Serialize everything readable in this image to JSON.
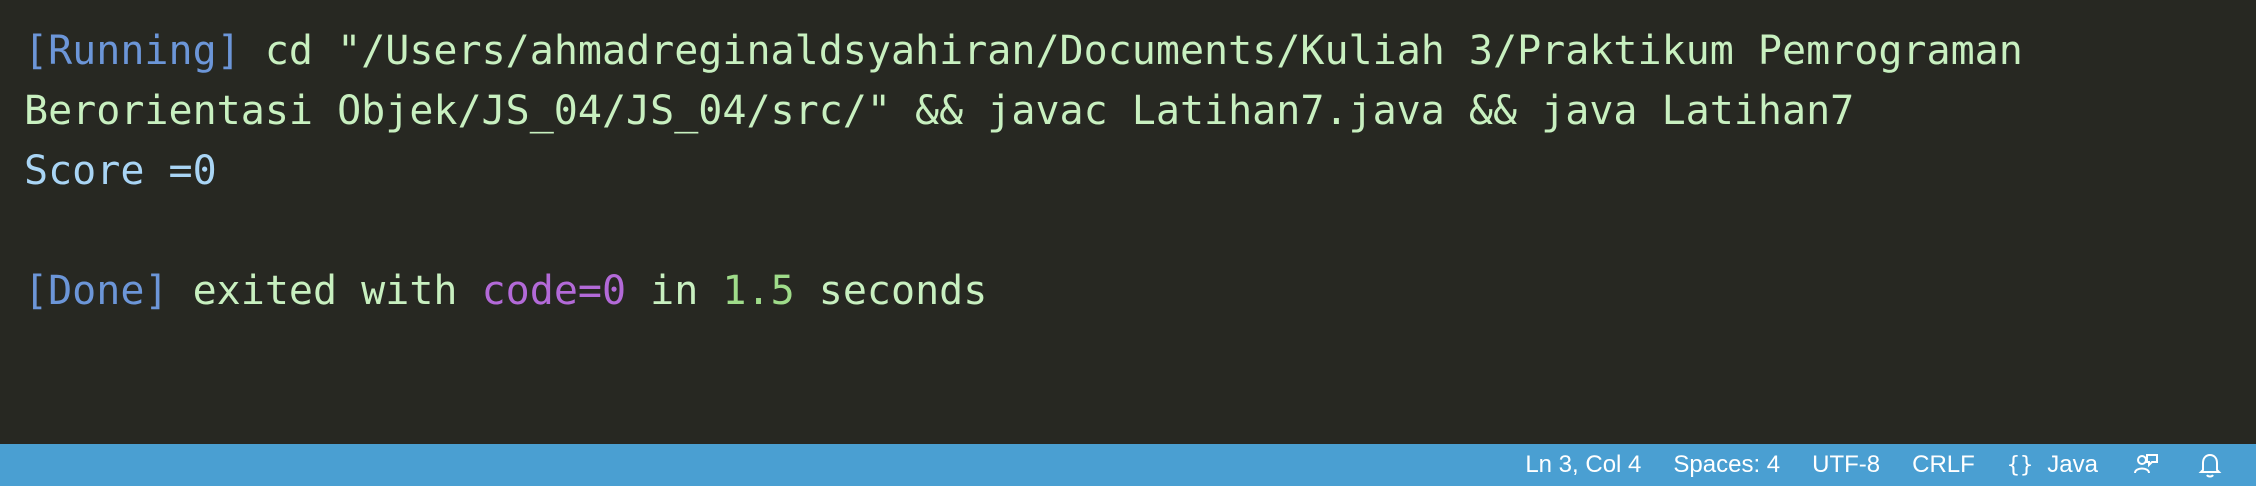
{
  "terminal": {
    "line1": {
      "tag": "[Running]",
      "command": " cd \"/Users/ahmadreginaldsyahiran/Documents/Kuliah 3/Praktikum Pemrograman"
    },
    "line2": {
      "command": "Berorientasi Objek/JS_04/JS_04/src/\" && javac Latihan7.java && java Latihan7"
    },
    "line3": {
      "output": "Score =0"
    },
    "line5": {
      "tag": "[Done]",
      "exited_with": " exited with ",
      "code": "code=0",
      "in": " in ",
      "duration": "1.5",
      "seconds": " seconds"
    }
  },
  "statusbar": {
    "cursor_position": "Ln 3, Col 4",
    "indentation": "Spaces: 4",
    "encoding": "UTF-8",
    "line_ending": "CRLF",
    "language_icon": "{}",
    "language": "Java",
    "feedback_icon": "feedback-person-icon",
    "notifications_icon": "bell-icon"
  }
}
